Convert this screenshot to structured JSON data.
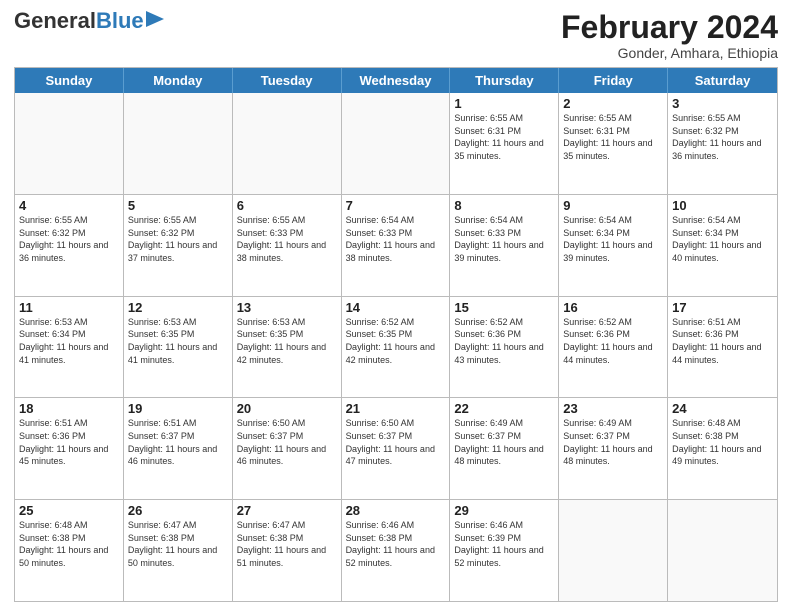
{
  "logo": {
    "line1": "General",
    "line2": "Blue"
  },
  "title": "February 2024",
  "subtitle": "Gonder, Amhara, Ethiopia",
  "days_of_week": [
    "Sunday",
    "Monday",
    "Tuesday",
    "Wednesday",
    "Thursday",
    "Friday",
    "Saturday"
  ],
  "weeks": [
    [
      {
        "day": "",
        "info": ""
      },
      {
        "day": "",
        "info": ""
      },
      {
        "day": "",
        "info": ""
      },
      {
        "day": "",
        "info": ""
      },
      {
        "day": "1",
        "info": "Sunrise: 6:55 AM\nSunset: 6:31 PM\nDaylight: 11 hours and 35 minutes."
      },
      {
        "day": "2",
        "info": "Sunrise: 6:55 AM\nSunset: 6:31 PM\nDaylight: 11 hours and 35 minutes."
      },
      {
        "day": "3",
        "info": "Sunrise: 6:55 AM\nSunset: 6:32 PM\nDaylight: 11 hours and 36 minutes."
      }
    ],
    [
      {
        "day": "4",
        "info": "Sunrise: 6:55 AM\nSunset: 6:32 PM\nDaylight: 11 hours and 36 minutes."
      },
      {
        "day": "5",
        "info": "Sunrise: 6:55 AM\nSunset: 6:32 PM\nDaylight: 11 hours and 37 minutes."
      },
      {
        "day": "6",
        "info": "Sunrise: 6:55 AM\nSunset: 6:33 PM\nDaylight: 11 hours and 38 minutes."
      },
      {
        "day": "7",
        "info": "Sunrise: 6:54 AM\nSunset: 6:33 PM\nDaylight: 11 hours and 38 minutes."
      },
      {
        "day": "8",
        "info": "Sunrise: 6:54 AM\nSunset: 6:33 PM\nDaylight: 11 hours and 39 minutes."
      },
      {
        "day": "9",
        "info": "Sunrise: 6:54 AM\nSunset: 6:34 PM\nDaylight: 11 hours and 39 minutes."
      },
      {
        "day": "10",
        "info": "Sunrise: 6:54 AM\nSunset: 6:34 PM\nDaylight: 11 hours and 40 minutes."
      }
    ],
    [
      {
        "day": "11",
        "info": "Sunrise: 6:53 AM\nSunset: 6:34 PM\nDaylight: 11 hours and 41 minutes."
      },
      {
        "day": "12",
        "info": "Sunrise: 6:53 AM\nSunset: 6:35 PM\nDaylight: 11 hours and 41 minutes."
      },
      {
        "day": "13",
        "info": "Sunrise: 6:53 AM\nSunset: 6:35 PM\nDaylight: 11 hours and 42 minutes."
      },
      {
        "day": "14",
        "info": "Sunrise: 6:52 AM\nSunset: 6:35 PM\nDaylight: 11 hours and 42 minutes."
      },
      {
        "day": "15",
        "info": "Sunrise: 6:52 AM\nSunset: 6:36 PM\nDaylight: 11 hours and 43 minutes."
      },
      {
        "day": "16",
        "info": "Sunrise: 6:52 AM\nSunset: 6:36 PM\nDaylight: 11 hours and 44 minutes."
      },
      {
        "day": "17",
        "info": "Sunrise: 6:51 AM\nSunset: 6:36 PM\nDaylight: 11 hours and 44 minutes."
      }
    ],
    [
      {
        "day": "18",
        "info": "Sunrise: 6:51 AM\nSunset: 6:36 PM\nDaylight: 11 hours and 45 minutes."
      },
      {
        "day": "19",
        "info": "Sunrise: 6:51 AM\nSunset: 6:37 PM\nDaylight: 11 hours and 46 minutes."
      },
      {
        "day": "20",
        "info": "Sunrise: 6:50 AM\nSunset: 6:37 PM\nDaylight: 11 hours and 46 minutes."
      },
      {
        "day": "21",
        "info": "Sunrise: 6:50 AM\nSunset: 6:37 PM\nDaylight: 11 hours and 47 minutes."
      },
      {
        "day": "22",
        "info": "Sunrise: 6:49 AM\nSunset: 6:37 PM\nDaylight: 11 hours and 48 minutes."
      },
      {
        "day": "23",
        "info": "Sunrise: 6:49 AM\nSunset: 6:37 PM\nDaylight: 11 hours and 48 minutes."
      },
      {
        "day": "24",
        "info": "Sunrise: 6:48 AM\nSunset: 6:38 PM\nDaylight: 11 hours and 49 minutes."
      }
    ],
    [
      {
        "day": "25",
        "info": "Sunrise: 6:48 AM\nSunset: 6:38 PM\nDaylight: 11 hours and 50 minutes."
      },
      {
        "day": "26",
        "info": "Sunrise: 6:47 AM\nSunset: 6:38 PM\nDaylight: 11 hours and 50 minutes."
      },
      {
        "day": "27",
        "info": "Sunrise: 6:47 AM\nSunset: 6:38 PM\nDaylight: 11 hours and 51 minutes."
      },
      {
        "day": "28",
        "info": "Sunrise: 6:46 AM\nSunset: 6:38 PM\nDaylight: 11 hours and 52 minutes."
      },
      {
        "day": "29",
        "info": "Sunrise: 6:46 AM\nSunset: 6:39 PM\nDaylight: 11 hours and 52 minutes."
      },
      {
        "day": "",
        "info": ""
      },
      {
        "day": "",
        "info": ""
      }
    ]
  ]
}
